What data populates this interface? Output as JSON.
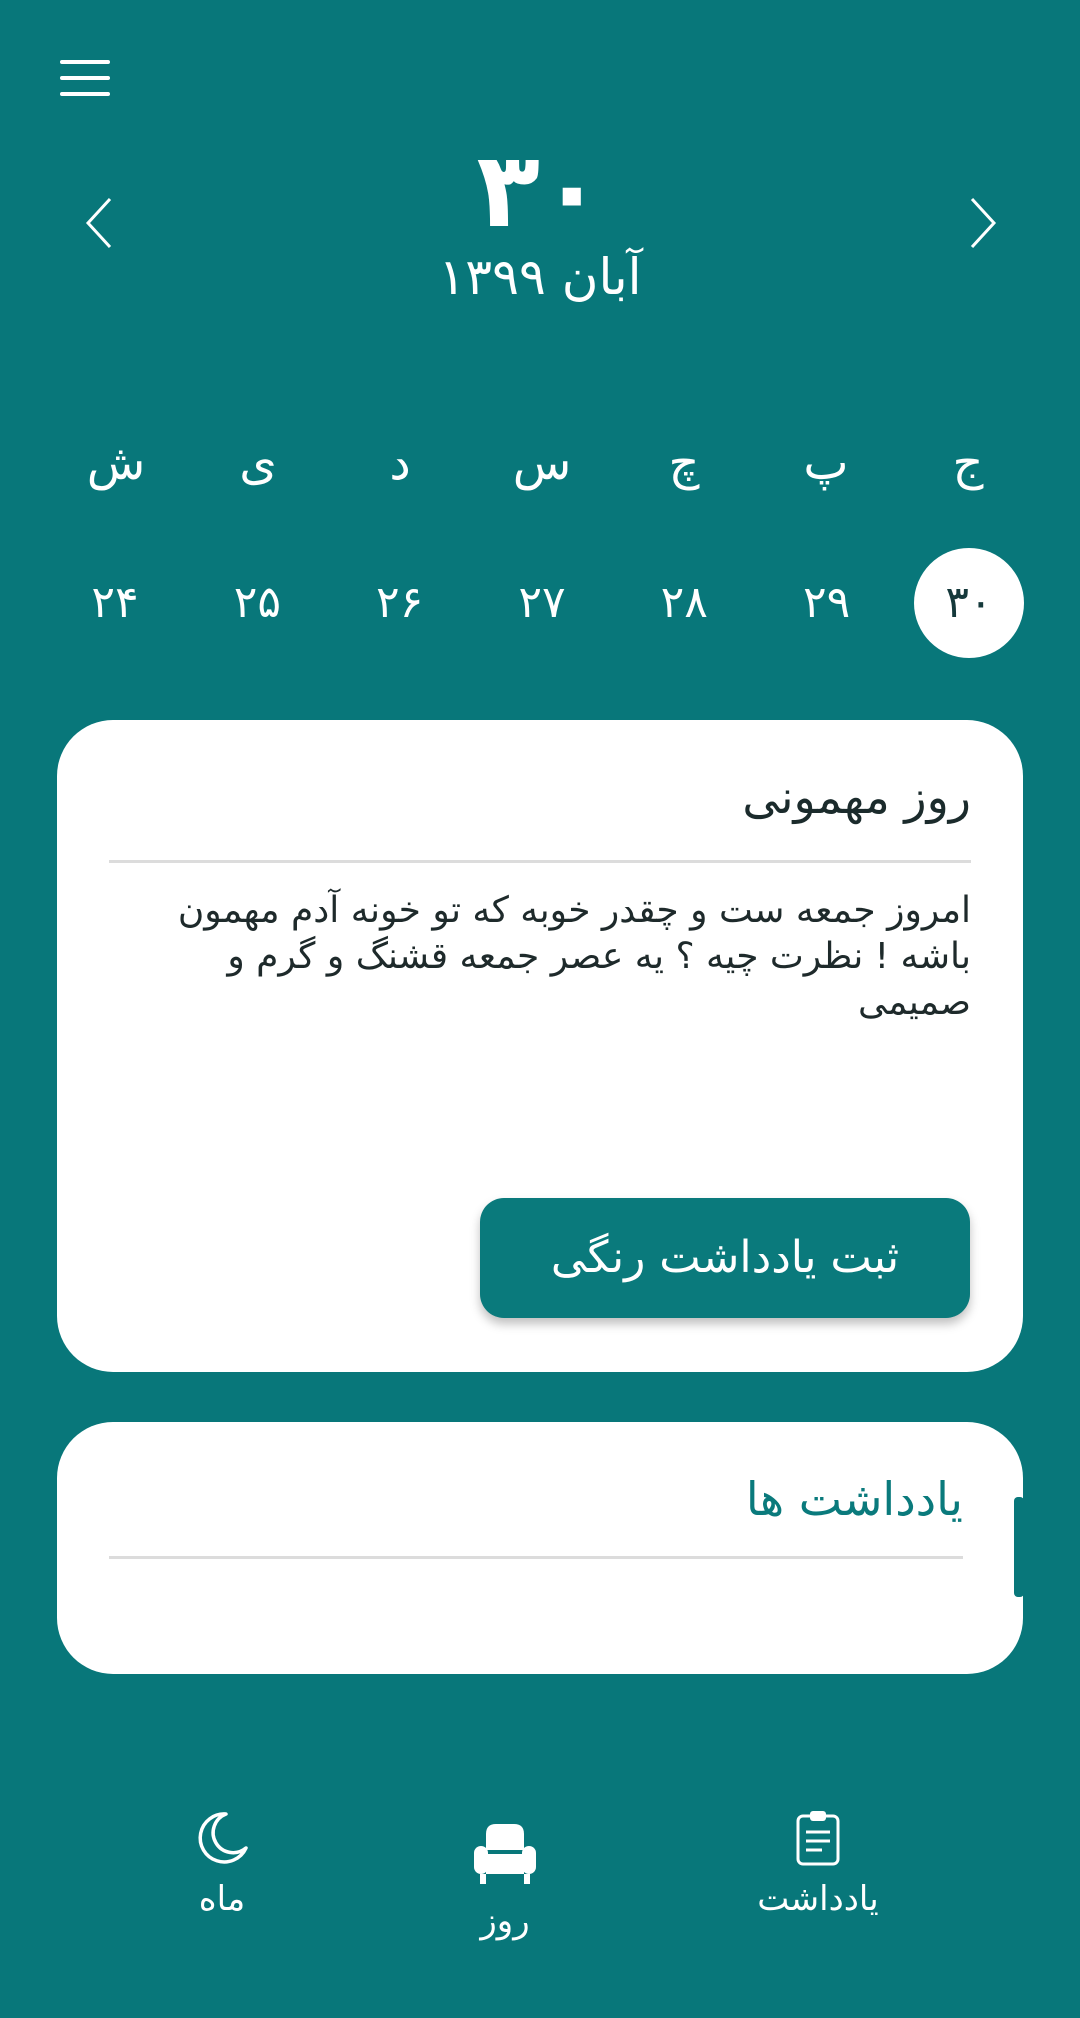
{
  "header": {
    "day_number": "۳۰",
    "month_year": "آبان ۱۳۹۹"
  },
  "week": {
    "weekdays": [
      "ج",
      "پ",
      "چ",
      "س",
      "د",
      "ی",
      "ش"
    ],
    "dates": [
      "۳۰",
      "۲۹",
      "۲۸",
      "۲۷",
      "۲۶",
      "۲۵",
      "۲۴"
    ],
    "selected_date": "۳۰"
  },
  "event_card": {
    "title": "روز مهمونی",
    "body": "امروز جمعه ست و چقدر خوبه که تو خونه آدم مهمون باشه ! نظرت چیه ؟ یه عصر جمعه قشنگ و گرم و صمیمی",
    "button_label": "ثبت یادداشت رنگی"
  },
  "notes_card": {
    "title": "یادداشت ها"
  },
  "bottom_nav": {
    "month_label": "ماه",
    "day_label": "روز",
    "note_label": "یادداشت"
  },
  "colors": {
    "background": "#08777a",
    "accent": "#0a7a7c",
    "card": "#ffffff"
  }
}
